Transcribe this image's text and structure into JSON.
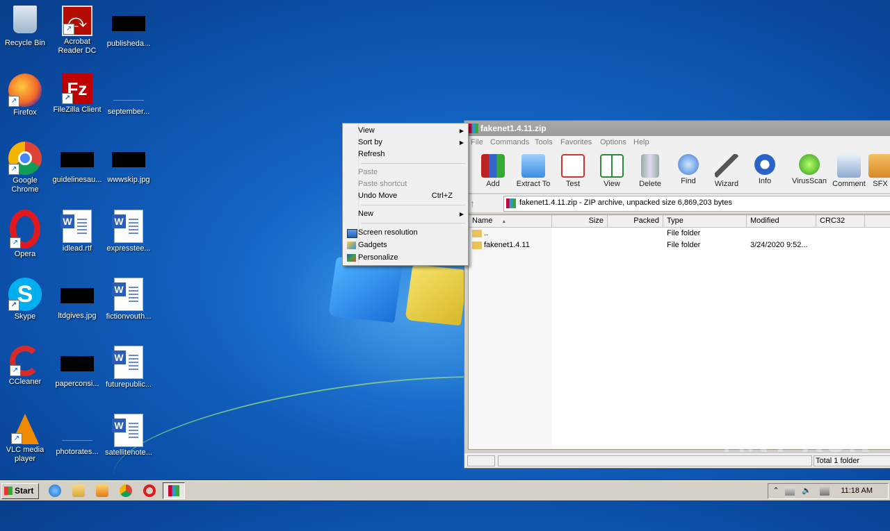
{
  "desktop_icons": [
    {
      "label": "Recycle Bin",
      "kind": "recycle"
    },
    {
      "label": "Acrobat Reader DC",
      "kind": "acrobat"
    },
    {
      "label": "publisheda...",
      "kind": "black"
    },
    {
      "label": "Firefox",
      "kind": "firefox"
    },
    {
      "label": "FileZilla Client",
      "kind": "filezilla"
    },
    {
      "label": "september...",
      "kind": "blank"
    },
    {
      "label": "Google Chrome",
      "kind": "chrome"
    },
    {
      "label": "guidelinesau...",
      "kind": "black"
    },
    {
      "label": "wwwskip.jpg",
      "kind": "black"
    },
    {
      "label": "Opera",
      "kind": "opera"
    },
    {
      "label": "idlead.rtf",
      "kind": "word"
    },
    {
      "label": "expresstee...",
      "kind": "word"
    },
    {
      "label": "Skype",
      "kind": "skype"
    },
    {
      "label": "ltdgives.jpg",
      "kind": "black"
    },
    {
      "label": "fictionvouth...",
      "kind": "word"
    },
    {
      "label": "CCleaner",
      "kind": "ccleaner"
    },
    {
      "label": "paperconsi...",
      "kind": "black"
    },
    {
      "label": "futurepublic...",
      "kind": "word"
    },
    {
      "label": "VLC media player",
      "kind": "vlc"
    },
    {
      "label": "photorates...",
      "kind": "blank"
    },
    {
      "label": "satellitenote...",
      "kind": "word"
    }
  ],
  "context_menu": {
    "items": [
      {
        "label": "View",
        "submenu": true,
        "disabled": false
      },
      {
        "label": "Sort by",
        "submenu": true,
        "disabled": false
      },
      {
        "label": "Refresh",
        "disabled": false
      },
      {
        "label": "Paste",
        "disabled": true
      },
      {
        "label": "Paste shortcut",
        "disabled": true
      },
      {
        "label": "Undo Move",
        "shortcut": "Ctrl+Z",
        "disabled": false
      },
      {
        "label": "New",
        "submenu": true,
        "disabled": false
      },
      {
        "label": "Screen resolution",
        "disabled": false,
        "icon": "screen-resolution-icon"
      },
      {
        "label": "Gadgets",
        "disabled": false,
        "icon": "gadgets-icon"
      },
      {
        "label": "Personalize",
        "disabled": false,
        "icon": "personalize-icon"
      }
    ]
  },
  "winrar": {
    "title": "fakenet1.4.11.zip",
    "menu": [
      "File",
      "Commands",
      "Tools",
      "Favorites",
      "Options",
      "Help"
    ],
    "toolbar": [
      "Add",
      "Extract To",
      "Test",
      "View",
      "Delete",
      "Find",
      "Wizard",
      "Info",
      "VirusScan",
      "Comment",
      "SFX"
    ],
    "address": "fakenet1.4.11.zip - ZIP archive, unpacked size 6,869,203 bytes",
    "columns": [
      "Name",
      "Size",
      "Packed",
      "Type",
      "Modified",
      "CRC32"
    ],
    "rows": [
      {
        "name": "..",
        "type": "File folder",
        "modified": ""
      },
      {
        "name": "fakenet1.4.11",
        "type": "File folder",
        "modified": "3/24/2020 9:52..."
      }
    ],
    "status": "Total 1 folder"
  },
  "watermark": "ANY RUN",
  "taskbar": {
    "start_label": "Start",
    "clock": "11:18 AM"
  }
}
